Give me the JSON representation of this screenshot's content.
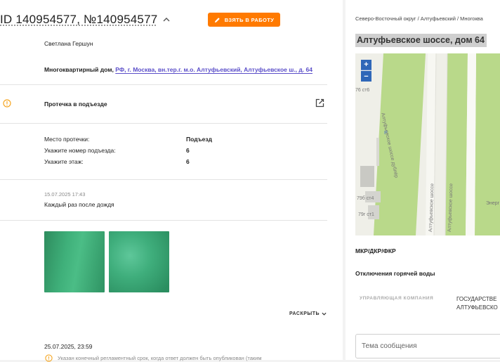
{
  "ticket": {
    "title": "ID 140954577, №140954577",
    "take_button_label": "ВЗЯТЬ В РАБОТУ",
    "author": "Светлана Гершун",
    "building_type": "Многоквартирный дом,",
    "address_link": "РФ, г. Москва, вн.тер.г. м.о. Алтуфьевский, Алтуфьевское ш., д. 64",
    "category": "Протечка в подъезде"
  },
  "fields": [
    {
      "label": "Место протечки:",
      "value": "Подъезд"
    },
    {
      "label": "Укажите номер подъезда:",
      "value": "6"
    },
    {
      "label": "Укажите этаж:",
      "value": "6"
    }
  ],
  "comment": {
    "timestamp": "15.07.2025 17:43",
    "text": "Каждый раз после дождя"
  },
  "expand_label": "РАСКРЫТЬ",
  "deadline": {
    "timestamp": "25.07.2025, 23:59",
    "note": "Указан конечный регламентный срок, когда ответ должен быть опубликован (таким"
  },
  "right_panel": {
    "breadcrumb": "Северо-Восточный округ / Алтуфьевский / Многоква",
    "address": "Алтуфьевское шоссе, дом 64",
    "map": {
      "zoom_in": "+",
      "zoom_out": "−",
      "labels": {
        "b76": "76 ст6",
        "dubler": "Алтуфьевское шоссе дублёр",
        "p": "P",
        "b79b": "79б ст4",
        "b79g": "79г ст1",
        "road1": "Алтуфьевское шоссе",
        "road2": "Алтуфьевское шоссе",
        "energ": "Энерг"
      }
    },
    "mkr_label": "МКР/ДКР/ФКР",
    "hot_water_label": "Отключения горячей воды",
    "management_label": "УПРАВЛЯЮЩАЯ КОМПАНИЯ",
    "management_value_line1": "ГОСУДАРСТВЕ",
    "management_value_line2": "АЛТУФЬЕВСКО",
    "subject_placeholder": "Тема сообщения"
  },
  "colors": {
    "accent_orange": "#ff7a00",
    "link_purple": "#5b4fc9",
    "warning_orange": "#f5a623",
    "map_green": "#b9d98a",
    "zoom_blue": "#2f67b8"
  }
}
